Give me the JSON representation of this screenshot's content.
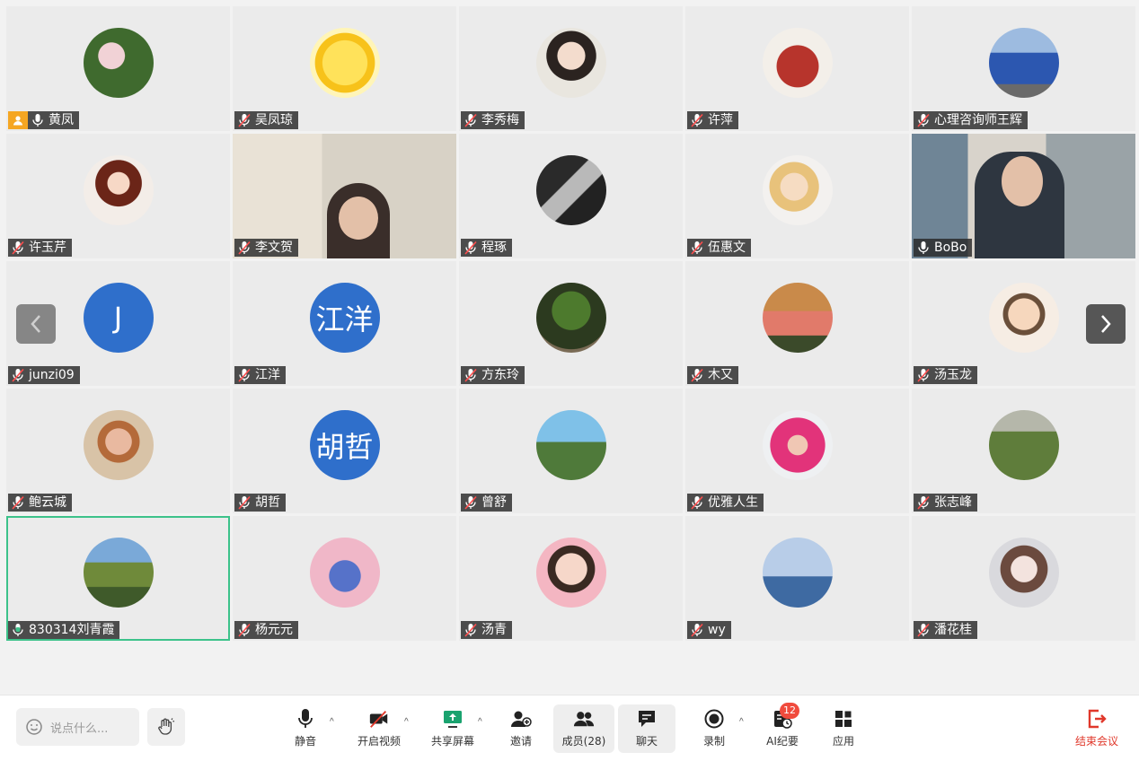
{
  "participants": [
    {
      "name": "黄凤",
      "host": true,
      "mic": "on"
    },
    {
      "name": "吴凤琼",
      "mic": "muted"
    },
    {
      "name": "李秀梅",
      "mic": "muted"
    },
    {
      "name": "许萍",
      "mic": "muted"
    },
    {
      "name": "心理咨询师王辉",
      "mic": "muted"
    },
    {
      "name": "许玉芹",
      "mic": "muted"
    },
    {
      "name": "李文贺",
      "mic": "muted",
      "video": true
    },
    {
      "name": "程琢",
      "mic": "muted"
    },
    {
      "name": "伍惠文",
      "mic": "muted"
    },
    {
      "name": "BoBo",
      "mic": "on",
      "video": true
    },
    {
      "name": "junzi09",
      "mic": "muted",
      "initials": "J"
    },
    {
      "name": "江洋",
      "mic": "muted",
      "initials": "江洋"
    },
    {
      "name": "方东玲",
      "mic": "muted"
    },
    {
      "name": "木又",
      "mic": "muted"
    },
    {
      "name": "汤玉龙",
      "mic": "muted"
    },
    {
      "name": "鲍云城",
      "mic": "muted"
    },
    {
      "name": "胡哲",
      "mic": "muted",
      "initials": "胡哲"
    },
    {
      "name": "曾舒",
      "mic": "muted"
    },
    {
      "name": "优雅人生",
      "mic": "muted"
    },
    {
      "name": "张志峰",
      "mic": "muted"
    },
    {
      "name": "830314刘青霞",
      "mic": "speaking",
      "active": true
    },
    {
      "name": "杨元元",
      "mic": "muted"
    },
    {
      "name": "汤青",
      "mic": "muted"
    },
    {
      "name": "wy",
      "mic": "muted"
    },
    {
      "name": "潘花桂",
      "mic": "muted"
    }
  ],
  "chat_placeholder": "说点什么...",
  "toolbar": {
    "mute": "静音",
    "video": "开启视频",
    "share": "共享屏幕",
    "invite": "邀请",
    "members": "成员(28)",
    "chat": "聊天",
    "record": "录制",
    "ai_notes": "AI纪要",
    "ai_badge": "12",
    "apps": "应用",
    "end": "结束会议"
  },
  "colors": {
    "accent_green": "#3cc28a",
    "host_orange": "#f5a623",
    "end_red": "#e0382b",
    "initials_blue": "#2f6fcb"
  },
  "icons": [
    "mic-icon",
    "video-off-icon",
    "share-screen-icon",
    "invite-icon",
    "members-icon",
    "chat-icon",
    "record-icon",
    "ai-notes-icon",
    "apps-icon",
    "end-meeting-icon",
    "raise-hand-icon",
    "smile-icon",
    "chevron-left-icon",
    "chevron-right-icon"
  ]
}
